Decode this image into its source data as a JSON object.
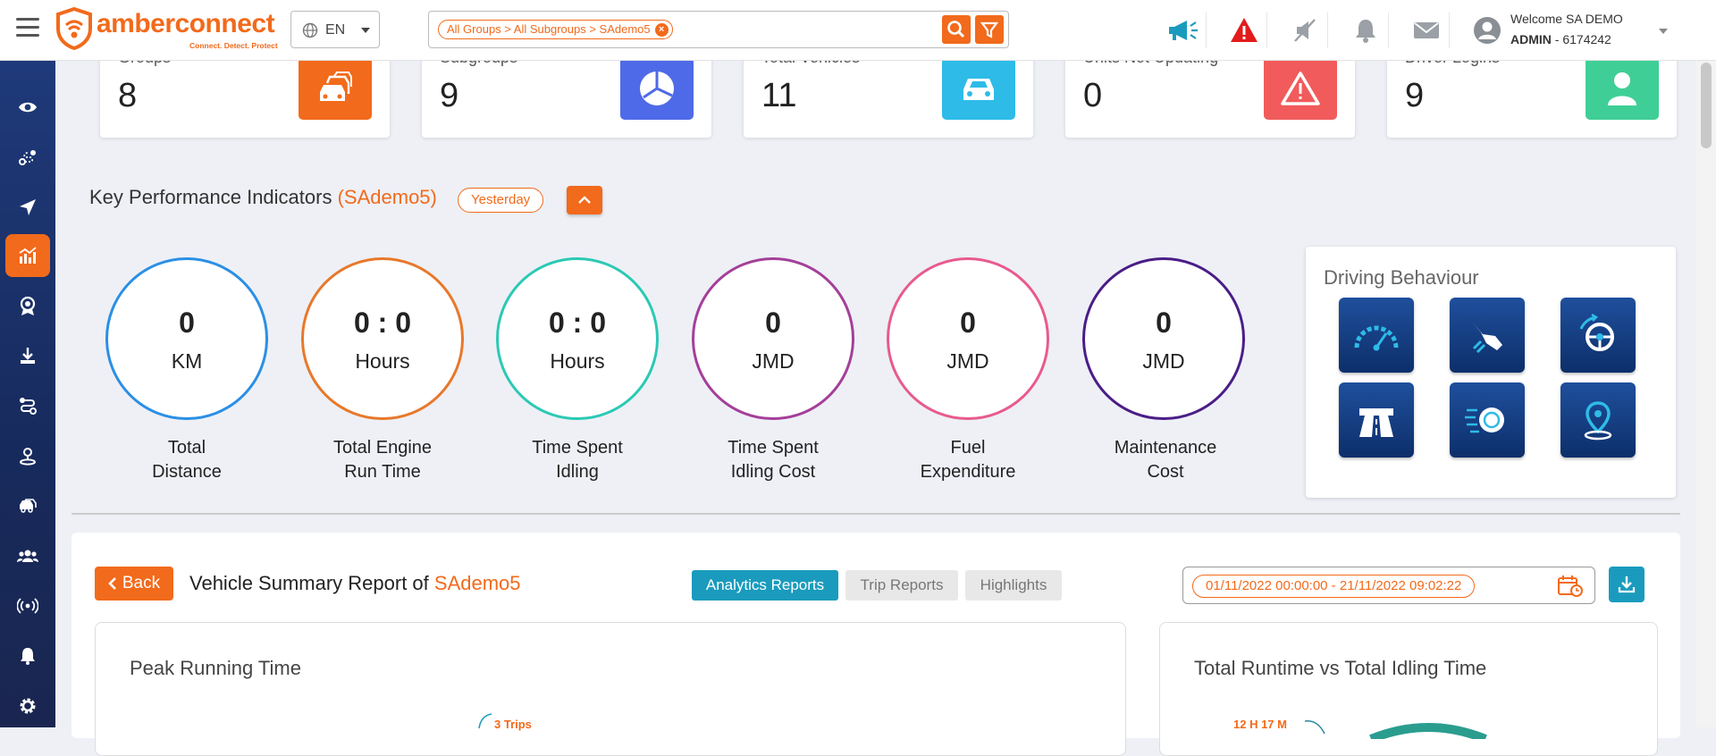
{
  "header": {
    "brand": "amberconnect",
    "tagline": "Connect. Detect. Protect",
    "language": "EN",
    "search_chip": "All Groups > All Subgroups > SAdemo5",
    "welcome": "Welcome SA DEMO",
    "role": "ADMIN",
    "account": " - 6174242"
  },
  "sidebar": {
    "items": [
      "eye-icon",
      "route-icon",
      "navigation-icon",
      "analytics-icon",
      "award-icon",
      "download-icon",
      "routes-icon",
      "location-user-icon",
      "vehicles-icon",
      "users-icon",
      "broadcast-icon",
      "alerts-icon",
      "settings-icon"
    ],
    "active": "analytics-icon"
  },
  "stats": [
    {
      "label": "Groups",
      "value": "8",
      "color": "#f26a1b",
      "icon": "cars-icon"
    },
    {
      "label": "Subgroups",
      "value": "9",
      "color": "#4f6ae8",
      "icon": "pie-icon"
    },
    {
      "label": "Total Vehicles",
      "value": "11",
      "color": "#2ebbe8",
      "icon": "car-icon"
    },
    {
      "label": "Units Not Updating",
      "value": "0",
      "color": "#f15b5b",
      "icon": "warning-icon"
    },
    {
      "label": "Driver Logins",
      "value": "9",
      "color": "#3fcf96",
      "icon": "person-icon"
    }
  ],
  "kpi": {
    "title": "Key Performance Indicators",
    "subject": "(SAdemo5)",
    "period": "Yesterday",
    "items": [
      {
        "value": "0",
        "unit": "KM",
        "label1": "Total",
        "label2": "Distance",
        "color": "#2b8fe5"
      },
      {
        "value": "0 : 0",
        "unit": "Hours",
        "label1": "Total Engine",
        "label2": "Run Time",
        "color": "#e8782a"
      },
      {
        "value": "0 : 0",
        "unit": "Hours",
        "label1": "Time Spent",
        "label2": "Idling",
        "color": "#2bc9b4"
      },
      {
        "value": "0",
        "unit": "JMD",
        "label1": "Time Spent",
        "label2": "Idling Cost",
        "color": "#a43f99"
      },
      {
        "value": "0",
        "unit": "JMD",
        "label1": "Fuel",
        "label2": "Expenditure",
        "color": "#e95a8c"
      },
      {
        "value": "0",
        "unit": "JMD",
        "label1": "Maintenance",
        "label2": "Cost",
        "color": "#4b1d87"
      }
    ]
  },
  "driving_behaviour": {
    "title": "Driving Behaviour",
    "icons": [
      "speedometer-icon",
      "harsh-braking-icon",
      "steering-icon",
      "highway-icon",
      "speeding-icon",
      "location-pin-icon"
    ]
  },
  "report": {
    "back": "Back",
    "title": "Vehicle Summary Report of ",
    "subject": "SAdemo5",
    "tabs": [
      "Analytics Reports",
      "Trip Reports",
      "Highlights"
    ],
    "date_range": "01/11/2022 00:00:00 - 21/11/2022 09:02:22",
    "panel1_title": "Peak Running Time",
    "panel1_note": "3 Trips",
    "panel2_title": "Total Runtime vs Total Idling Time",
    "panel2_note": "12 H 17 M"
  }
}
